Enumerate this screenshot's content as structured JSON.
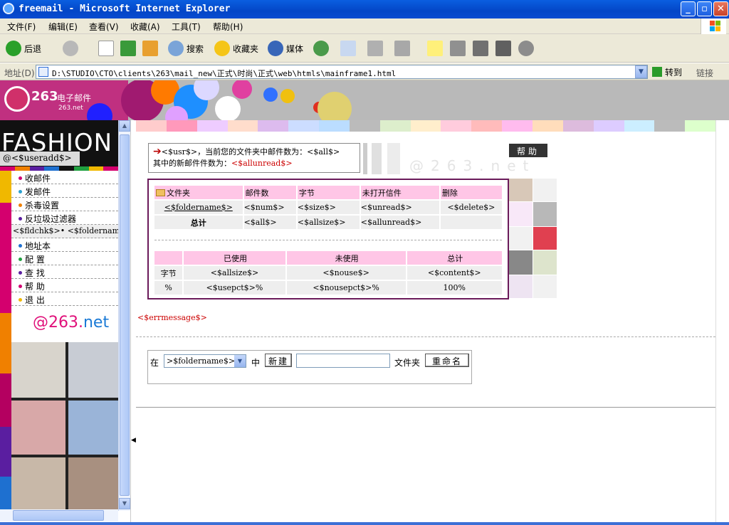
{
  "window": {
    "title": "freemail - Microsoft Internet Explorer",
    "minimize": "_",
    "maximize": "▫",
    "close": "✕"
  },
  "menu": [
    "文件(F)",
    "编辑(E)",
    "查看(V)",
    "收藏(A)",
    "工具(T)",
    "帮助(H)"
  ],
  "toolbar": {
    "back": "后退",
    "search": "搜索",
    "favorites": "收藏夹",
    "media": "媒体"
  },
  "address": {
    "label": "地址(D)",
    "url": "D:\\STUDIO\\CTO\\clients\\263\\mail_new\\正式\\时尚\\正式\\web\\htmls\\mainframe1.html",
    "go": "转到",
    "links": "链接"
  },
  "banner": {
    "logo_num": "263",
    "logo_text": "电子邮件",
    "logo_sub": "263.net"
  },
  "sidebar": {
    "fashion": "FASHION",
    "useradd": "@<$useradd$>",
    "items": [
      {
        "label": "收邮件",
        "dot": "#d00070"
      },
      {
        "label": "发邮件",
        "dot": "#2aa0d0"
      },
      {
        "label": "杀毒设置",
        "dot": "#f08000"
      },
      {
        "label": "反垃圾过滤器",
        "dot": "#5a1ea0"
      }
    ],
    "folders": "<$fldchk$>• <$foldername$>",
    "items2": [
      {
        "label": "地址本",
        "dot": "#1e70d0"
      },
      {
        "label": "配  置",
        "dot": "#20a040"
      },
      {
        "label": "查  找",
        "dot": "#5a1ea0"
      },
      {
        "label": "帮  助",
        "dot": "#d00070"
      },
      {
        "label": "退  出",
        "dot": "#f0b800"
      }
    ],
    "brand_at": "@263.",
    "brand_net": "net"
  },
  "main": {
    "info_line1_pre": "<$usr$>，当前您的文件夹中邮件数为：",
    "info_line1_val": "<$all$>",
    "info_line2_pre": "其中的新邮件件数为：",
    "info_line2_val": "<$allunread$>",
    "help": "帮助",
    "watermark": "@263.net",
    "folder_table": {
      "headers": [
        "文件夹",
        "邮件数",
        "字节",
        "未打开信件",
        "删除"
      ],
      "row": [
        "<$foldername$>",
        "<$num$>",
        "<$size$>",
        "<$unread$>",
        "<$delete$>"
      ],
      "total": [
        "总计",
        "<$all$>",
        "<$allsize$>",
        "<$allunread$>",
        ""
      ]
    },
    "usage_table": {
      "headers": [
        "",
        "已使用",
        "未使用",
        "总计"
      ],
      "rows": [
        [
          "字节",
          "<$allsize$>",
          "<$nouse$>",
          "<$content$>"
        ],
        [
          "%",
          "<$usepct$>%",
          "<$nousepct$>%",
          "100%"
        ]
      ]
    },
    "errmessage": "<$errmessage$>",
    "form": {
      "prefix": "在",
      "select_value": ">$foldername$>",
      "middle": "中",
      "new_btn": "新建",
      "suffix": "文件夹",
      "rename_btn": "重命名"
    }
  },
  "colors": {
    "accent_magenta": "#d4006e",
    "box_border": "#6a1a5a",
    "table_header_pink": "#ffc6e6"
  }
}
